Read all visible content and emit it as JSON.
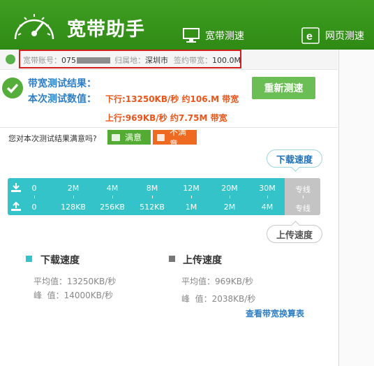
{
  "header": {
    "title": "宽带助手",
    "nav": [
      {
        "label": "宽带测速",
        "icon": "monitor-icon"
      },
      {
        "label": "网页测速",
        "icon": "ie-browser-icon"
      }
    ]
  },
  "account": {
    "account_label": "宽带账号：",
    "account_prefix": "075",
    "location_label": "归属地：",
    "location_value": "深圳市",
    "bandwidth_label": "签约带宽：",
    "bandwidth_value": "100.0M"
  },
  "result": {
    "title": "带宽测试结果：",
    "subtitle": "本次测试数值：",
    "download_line": "下行:13250KB/秒 约106.M 带宽",
    "upload_line": "上行:969KB/秒 约7.75M 带宽",
    "retest_label": "重新测速"
  },
  "satisfaction": {
    "question": "您对本次测试结果满意吗?",
    "yes_label": "满意",
    "no_label": "不满意"
  },
  "bubbles": {
    "download": "下载速度",
    "upload": "上传速度"
  },
  "scale": {
    "download_ticks": [
      "0",
      "2M",
      "4M",
      "8M",
      "12M",
      "20M",
      "30M",
      "专线"
    ],
    "upload_ticks": [
      "0",
      "128KB",
      "256KB",
      "512KB",
      "1M",
      "2M",
      "4M",
      "专线"
    ]
  },
  "stats": {
    "download_title": "下载速度",
    "download_avg": "平均值：13250KB/秒",
    "download_peak": "峰  值：14000KB/秒",
    "upload_title": "上传速度",
    "upload_avg": "平均值：969KB/秒",
    "upload_peak": "峰  值：2038KB/秒",
    "link": "查看带宽换算表"
  },
  "colors": {
    "header_green": "#3f9e22",
    "accent_blue": "#2f7fc5",
    "orange": "#e8561d",
    "scale_cyan": "#34c3c9",
    "highlight_red": "#d71e1e"
  }
}
